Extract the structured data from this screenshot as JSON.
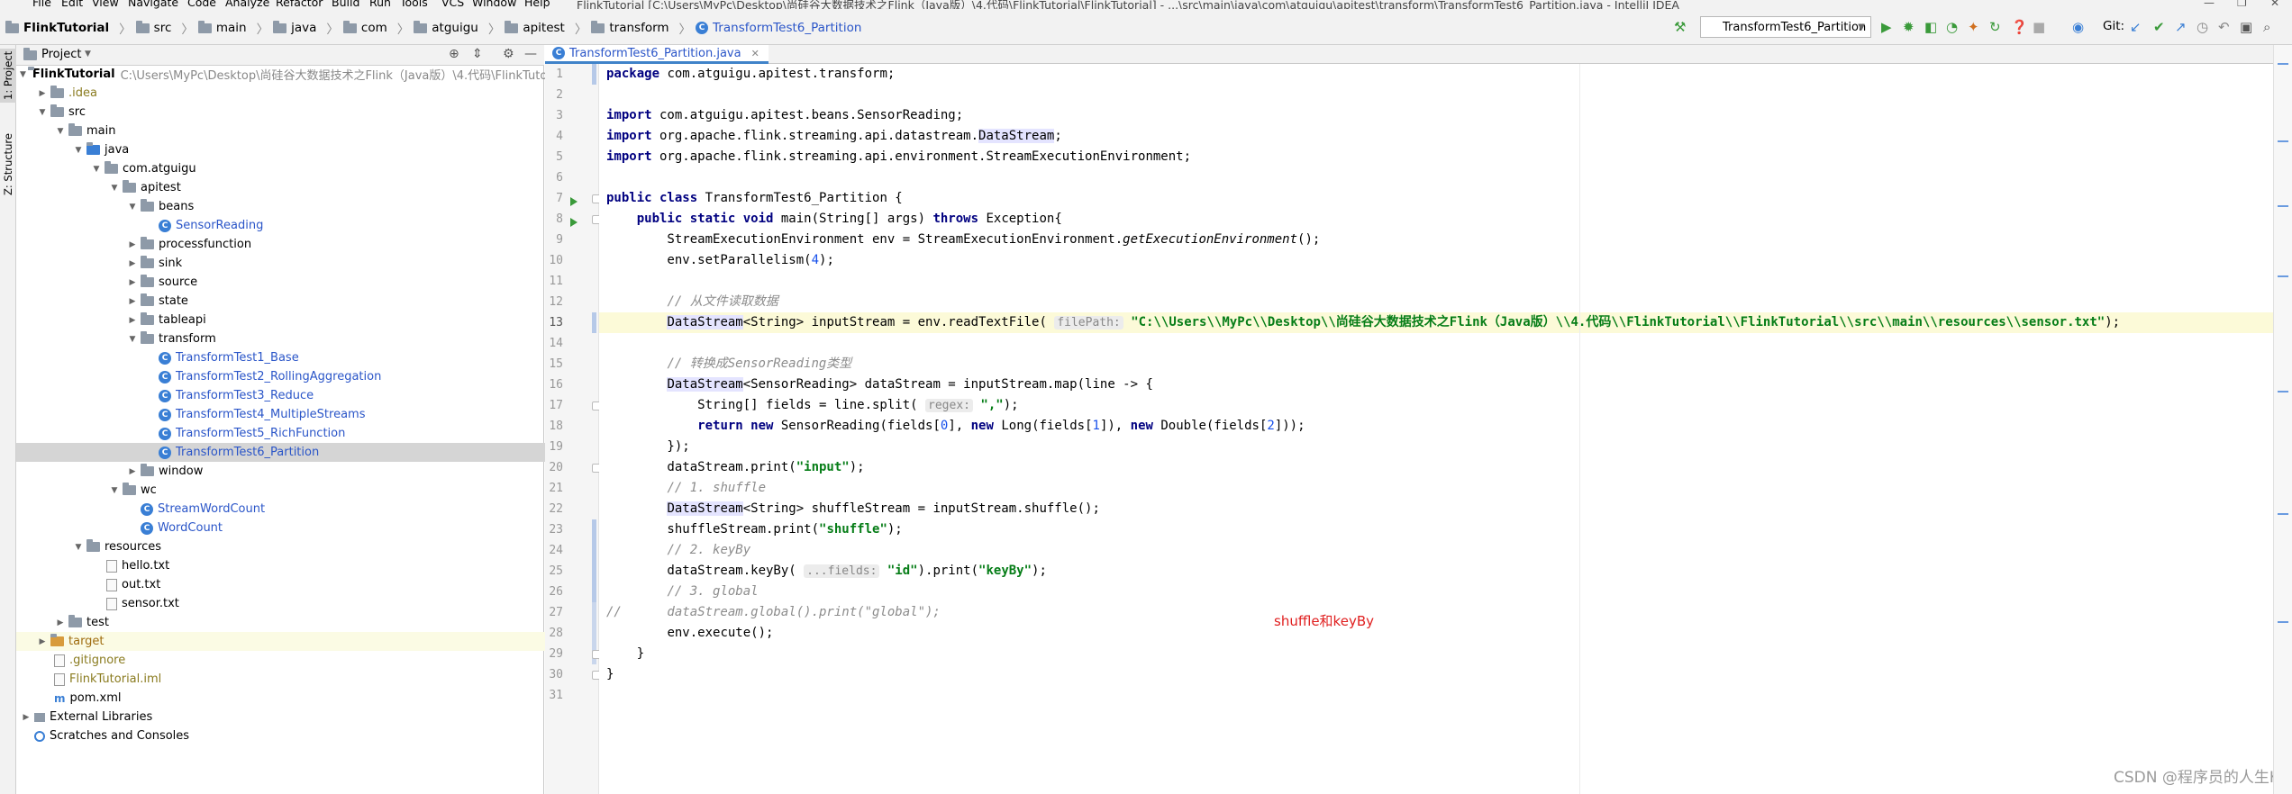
{
  "window": {
    "menu": [
      "File",
      "Edit",
      "View",
      "Navigate",
      "Code",
      "Analyze",
      "Refactor",
      "Build",
      "Run",
      "Tools",
      "VCS",
      "Window",
      "Help"
    ],
    "title": "FlinkTutorial [C:\\Users\\MyPc\\Desktop\\尚硅谷大数据技术之Flink（Java版）\\4.代码\\FlinkTutorial\\FlinkTutorial] - ...\\src\\main\\java\\com\\atguigu\\apitest\\transform\\TransformTest6_Partition.java - IntelliJ IDEA"
  },
  "breadcrumbs": [
    "FlinkTutorial",
    "src",
    "main",
    "java",
    "com",
    "atguigu",
    "apitest",
    "transform",
    "TransformTest6_Partition"
  ],
  "toolbar": {
    "run_config": "TransformTest6_Partition",
    "git_label": "Git:"
  },
  "left_tabs": [
    "1: Project",
    "Z: Structure"
  ],
  "project_panel": {
    "title": "Project",
    "tree": [
      {
        "label": "FlinkTutorial",
        "path": "C:\\Users\\MyPc\\Desktop\\尚硅谷大数据技术之Flink（Java版）\\4.代码\\FlinkTutorial\\"
      },
      {
        "label": ".idea"
      },
      {
        "label": "src"
      },
      {
        "label": "main"
      },
      {
        "label": "java"
      },
      {
        "label": "com.atguigu"
      },
      {
        "label": "apitest"
      },
      {
        "label": "beans"
      },
      {
        "label": "SensorReading"
      },
      {
        "label": "processfunction"
      },
      {
        "label": "sink"
      },
      {
        "label": "source"
      },
      {
        "label": "state"
      },
      {
        "label": "tableapi"
      },
      {
        "label": "transform"
      },
      {
        "label": "TransformTest1_Base"
      },
      {
        "label": "TransformTest2_RollingAggregation"
      },
      {
        "label": "TransformTest3_Reduce"
      },
      {
        "label": "TransformTest4_MultipleStreams"
      },
      {
        "label": "TransformTest5_RichFunction"
      },
      {
        "label": "TransformTest6_Partition"
      },
      {
        "label": "window"
      },
      {
        "label": "wc"
      },
      {
        "label": "StreamWordCount"
      },
      {
        "label": "WordCount"
      },
      {
        "label": "resources"
      },
      {
        "label": "hello.txt"
      },
      {
        "label": "out.txt"
      },
      {
        "label": "sensor.txt"
      },
      {
        "label": "test"
      },
      {
        "label": "target"
      },
      {
        "label": ".gitignore"
      },
      {
        "label": "FlinkTutorial.iml"
      },
      {
        "label": "pom.xml"
      },
      {
        "label": "External Libraries"
      },
      {
        "label": "Scratches and Consoles"
      }
    ]
  },
  "editor": {
    "tab_label": "TransformTest6_Partition.java",
    "line_numbers": [
      "1",
      "2",
      "3",
      "4",
      "5",
      "6",
      "7",
      "8",
      "9",
      "10",
      "11",
      "12",
      "13",
      "14",
      "15",
      "16",
      "17",
      "18",
      "19",
      "20",
      "21",
      "22",
      "23",
      "24",
      "25",
      "26",
      "27",
      "28",
      "29",
      "30",
      "31"
    ],
    "hints": {
      "filepath": "filePath:",
      "regex": "regex:",
      "fields": "...fields:"
    },
    "strings": {
      "pkg": "package com.atguigu.apitest.transform;",
      "imp1": "import com.atguigu.apitest.beans.SensorReading;",
      "imp2a": "import org.apache.flink.streaming.api.datastream.",
      "imp2b": "DataStream",
      "imp3": "import org.apache.flink.streaming.api.environment.StreamExecutionEnvironment;",
      "cls": "public class TransformTest6_Partition {",
      "main": "public static void main(String[] args) throws Exception{",
      "env": "StreamExecutionEnvironment env = StreamExecutionEnvironment.getExecutionEnvironment();",
      "par": "env.setParallelism(4);",
      "c1": "// 从文件读取数据",
      "read_path": "\"C:\\\\Users\\\\MyPc\\\\Desktop\\\\尚硅谷大数据技术之Flink（Java版）\\\\4.代码\\\\FlinkTutorial\\\\FlinkTutorial\\\\src\\\\main\\\\resources\\\\sensor.txt\"",
      "c2": "// 转换成SensorReading类型",
      "c3": "// 1. shuffle",
      "c4": "// 2. keyBy",
      "c5": "// 3. global",
      "l27": "//      dataStream.global().print(\"global\");",
      "exec": "env.execute();"
    }
  },
  "annotation": "shuffle和keyBy",
  "watermark": "CSDN @程序员的人生K"
}
